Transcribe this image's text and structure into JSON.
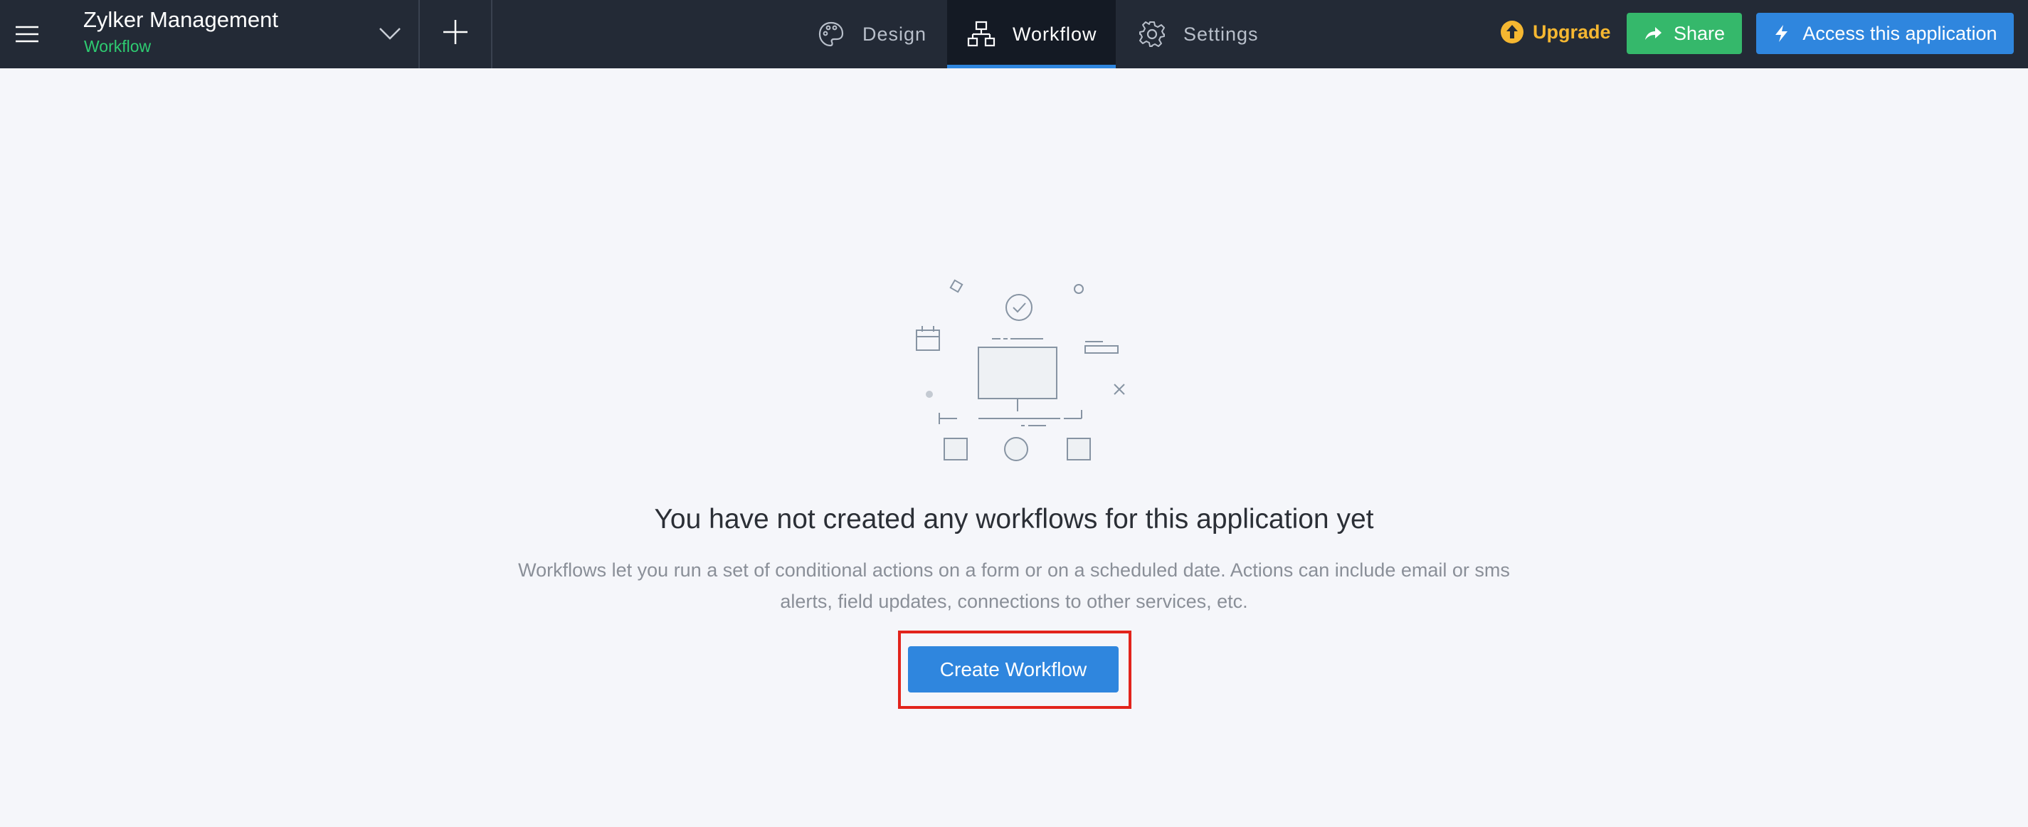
{
  "header": {
    "app_title": "Zylker Management",
    "app_subtitle": "Workflow",
    "tabs": [
      {
        "label": "Design",
        "icon": "palette-icon",
        "active": false
      },
      {
        "label": "Workflow",
        "icon": "workflow-icon",
        "active": true
      },
      {
        "label": "Settings",
        "icon": "gear-icon",
        "active": false
      }
    ],
    "upgrade_label": "Upgrade",
    "share_label": "Share",
    "access_label": "Access this application"
  },
  "empty_state": {
    "title": "You have not created any workflows for this application yet",
    "description": "Workflows let you run a set of conditional actions on a form or on a scheduled date. Actions can include email or sms alerts, field updates, connections to other services, etc.",
    "button_label": "Create Workflow"
  },
  "colors": {
    "topbar_bg": "#232a36",
    "active_tab_bg": "#141a24",
    "accent_blue": "#2f86de",
    "share_green": "#35b86b",
    "subtitle_green": "#2ecc71",
    "upgrade_yellow": "#f5b731",
    "highlight_red": "#e2241c",
    "page_bg": "#f5f6fa"
  }
}
